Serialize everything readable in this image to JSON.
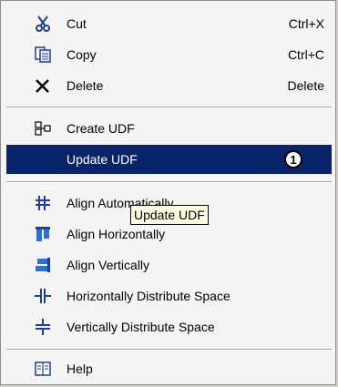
{
  "menu": {
    "items": [
      {
        "label": "Cut",
        "shortcut": "Ctrl+X",
        "icon": "scissors-icon"
      },
      {
        "label": "Copy",
        "shortcut": "Ctrl+C",
        "icon": "copy-icon"
      },
      {
        "label": "Delete",
        "shortcut": "Delete",
        "icon": "delete-x-icon"
      },
      {
        "label": "Create UDF",
        "icon": "udf-icon"
      },
      {
        "label": "Update UDF",
        "badge": "1",
        "highlighted": true
      },
      {
        "label": "Align Automatically",
        "icon": "align-auto-icon"
      },
      {
        "label": "Align Horizontally",
        "icon": "align-horizontal-icon"
      },
      {
        "label": "Align Vertically",
        "icon": "align-vertical-icon"
      },
      {
        "label": "Horizontally Distribute Space",
        "icon": "distribute-horizontal-icon"
      },
      {
        "label": "Vertically Distribute Space",
        "icon": "distribute-vertical-icon"
      },
      {
        "label": "Help",
        "icon": "help-icon"
      }
    ]
  },
  "tooltip": {
    "text": "Update UDF"
  },
  "colors": {
    "highlight": "#0a246a",
    "menu_bg": "#f4f4f4"
  }
}
